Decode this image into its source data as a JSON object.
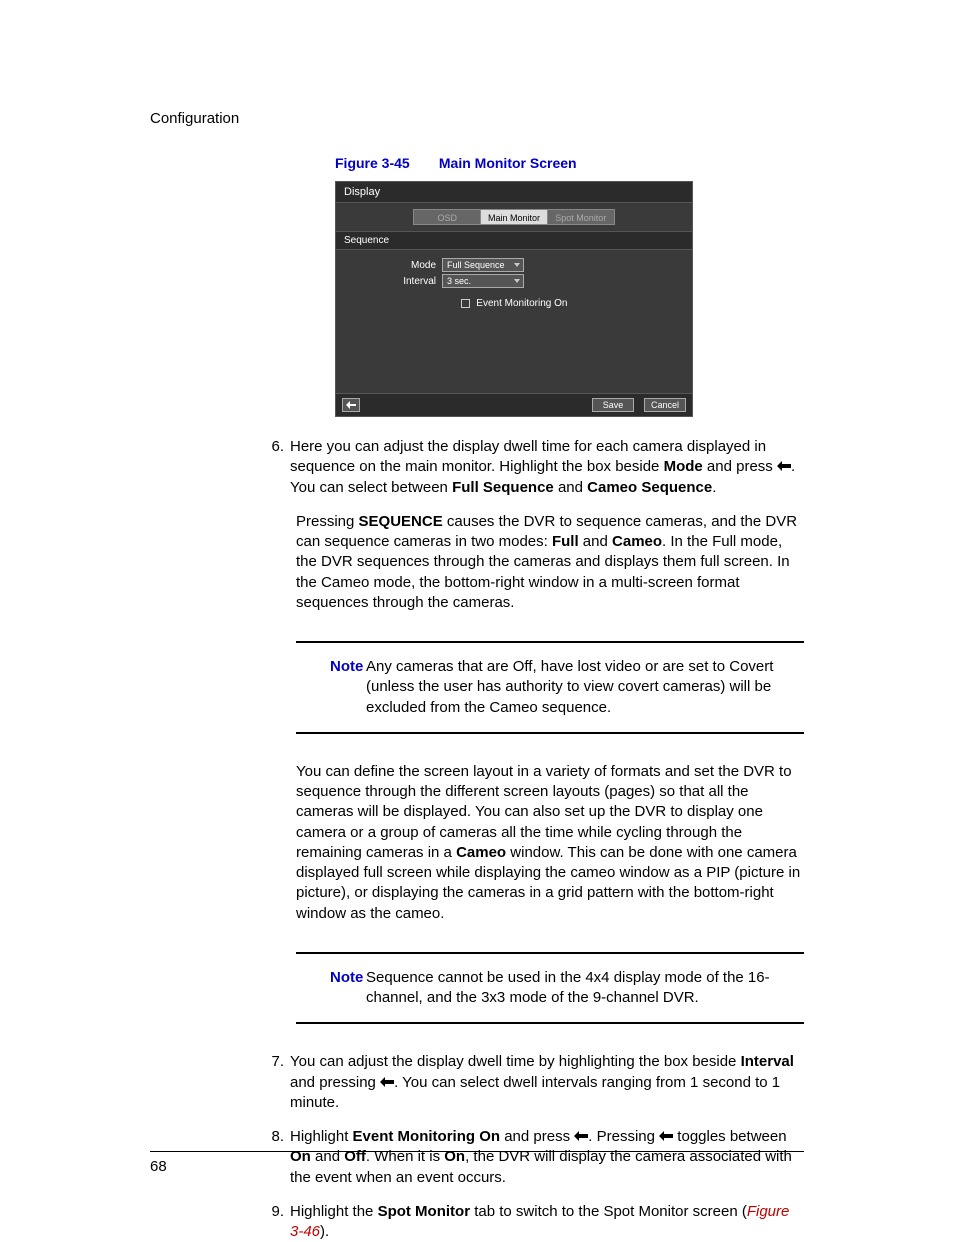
{
  "header": {
    "section": "Configuration"
  },
  "figure": {
    "id": "Figure 3-45",
    "title": "Main Monitor Screen",
    "ui": {
      "panel_title": "Display",
      "tabs": {
        "osd": "OSD",
        "main": "Main Monitor",
        "spot": "Spot Monitor"
      },
      "subhead": "Sequence",
      "mode_label": "Mode",
      "mode_value": "Full Sequence",
      "interval_label": "Interval",
      "interval_value": "3 sec.",
      "checkbox_label": "Event Monitoring On",
      "save": "Save",
      "cancel": "Cancel"
    }
  },
  "steps": {
    "s6_num": "6.",
    "s6a": "Here you can adjust the display dwell time for each camera displayed in sequence on the main monitor. Highlight the box beside ",
    "s6_mode": "Mode",
    "s6b": " and press ",
    "s6c": ". You can select between ",
    "s6_full": "Full Sequence",
    "s6_and": " and ",
    "s6_cameo": "Cameo Sequence",
    "s6d": ".",
    "p6a": "Pressing ",
    "p6_seq": "SEQUENCE",
    "p6b": " causes the DVR to sequence cameras, and the DVR can sequence cameras in two modes: ",
    "p6_full": "Full",
    "p6_and": " and ",
    "p6_cameo": "Cameo",
    "p6c": ". In the Full mode, the DVR sequences through the cameras and displays them full screen. In the Cameo mode, the bottom-right window in a multi-screen format sequences through the cameras.",
    "note_label": "Note",
    "note1": "Any cameras that are Off, have lost video or are set to Covert (unless the user has authority to view covert cameras) will be excluded from the Cameo sequence.",
    "p7a": "You can define the screen layout in a variety of formats and set the DVR to sequence through the different screen layouts (pages) so that all the cameras will be displayed. You can also set up the DVR to display one camera or a group of cameras all the time while cycling through the remaining cameras in a ",
    "p7_cameo": "Cameo",
    "p7b": " window. This can be done with one camera displayed full screen while displaying the cameo window as a PIP (picture in picture), or displaying the cameras in a grid pattern with the bottom-right window as the cameo.",
    "note2": "Sequence cannot be used in the 4x4 display mode of the 16-channel, and the 3x3 mode of the 9-channel DVR.",
    "s7_num": "7.",
    "s7a": "You can adjust the display dwell time by highlighting the box beside ",
    "s7_int": "Interval",
    "s7b": " and pressing ",
    "s7c": ". You can select dwell intervals ranging from 1 second to 1 minute.",
    "s8_num": "8.",
    "s8a": "Highlight ",
    "s8_em": "Event Monitoring On",
    "s8b": " and press ",
    "s8c": ". Pressing ",
    "s8d": " toggles between ",
    "s8_on": "On",
    "s8e": " and ",
    "s8_off": "Off",
    "s8f": ". When it is ",
    "s8_on2": "On",
    "s8g": ", the DVR will display the camera associated with the event when an event occurs.",
    "s9_num": "9.",
    "s9a": "Highlight the ",
    "s9_sm": "Spot Monitor",
    "s9b": " tab to switch to the Spot Monitor screen (",
    "s9_ref": "Figure 3-46",
    "s9c": ")."
  },
  "footer": {
    "page": "68"
  }
}
